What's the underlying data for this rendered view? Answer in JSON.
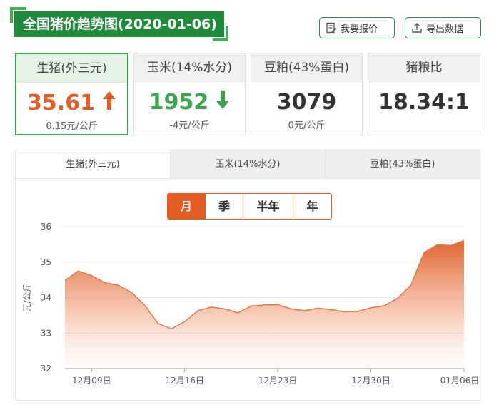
{
  "header": {
    "title": "全国猪价趋势图(2020-01-06)",
    "report_button": "我要报价",
    "export_button": "导出数据"
  },
  "cards": [
    {
      "label": "生猪(外三元)",
      "value": "35.61",
      "change": "0.15元/公斤",
      "trend": "up",
      "arrow_icon": "arrow-up-icon"
    },
    {
      "label": "玉米(14%水分)",
      "value": "1952",
      "change": "-4元/公斤",
      "trend": "down",
      "arrow_icon": "arrow-down-icon"
    },
    {
      "label": "豆粕(43%蛋白)",
      "value": "3079",
      "change": "0元/公斤",
      "trend": "neutral"
    },
    {
      "label": "猪粮比",
      "value": "18.34:1",
      "change": "",
      "trend": "neutral"
    }
  ],
  "chart_tabs": [
    "生猪(外三元)",
    "玉米(14%水分)",
    "豆粕(43%蛋白)"
  ],
  "periods": [
    "月",
    "季",
    "半年",
    "年"
  ],
  "colors": {
    "brand_green": "#1f8b3a",
    "accent_orange": "#e25c23",
    "down_green": "#3aa54d",
    "line": "#e0794a"
  },
  "chart_data": {
    "type": "area",
    "title": "",
    "xlabel": "",
    "ylabel": "元/公斤",
    "ylim": [
      32,
      36
    ],
    "yticks": [
      32,
      33,
      34,
      35,
      36
    ],
    "x_tick_labels": [
      "12月09日",
      "12月16日",
      "12月23日",
      "12月30日",
      "01月06日"
    ],
    "grid": true,
    "x": [
      "12-07",
      "12-08",
      "12-09",
      "12-10",
      "12-11",
      "12-12",
      "12-13",
      "12-14",
      "12-15",
      "12-16",
      "12-17",
      "12-18",
      "12-19",
      "12-20",
      "12-21",
      "12-22",
      "12-23",
      "12-24",
      "12-25",
      "12-26",
      "12-27",
      "12-28",
      "12-29",
      "12-30",
      "12-31",
      "01-01",
      "01-02",
      "01-03",
      "01-04",
      "01-05",
      "01-06"
    ],
    "series": [
      {
        "values": [
          34.48,
          34.75,
          34.62,
          34.42,
          34.35,
          34.15,
          33.78,
          33.27,
          33.12,
          33.32,
          33.63,
          33.73,
          33.68,
          33.57,
          33.76,
          33.79,
          33.8,
          33.68,
          33.63,
          33.7,
          33.66,
          33.6,
          33.61,
          33.71,
          33.77,
          33.98,
          34.35,
          35.27,
          35.49,
          35.47,
          35.61
        ]
      }
    ]
  }
}
